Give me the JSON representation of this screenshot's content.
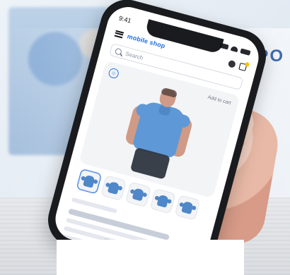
{
  "scene": {
    "brochure_word": "PO",
    "phone": {
      "status_time": "9:41",
      "brand": "mobile shop",
      "search_placeholder": "Search",
      "product_action": "Add to cart",
      "colors": {
        "brand_blue": "#1f6fe0",
        "shirt_blue": "#5f98d7",
        "badge_yellow": "#f2c200"
      }
    }
  }
}
